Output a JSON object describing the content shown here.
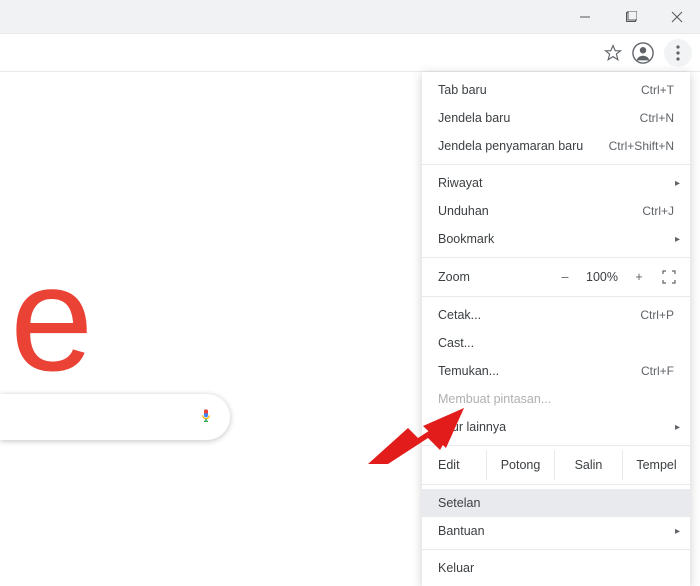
{
  "window_controls": {
    "minimize": "minimize",
    "maximize": "maximize",
    "close": "close"
  },
  "toolbar": {
    "star": "star-icon",
    "profile": "profile-icon",
    "menu": "menu-icon"
  },
  "logo_fragment": "e",
  "menu": {
    "items": [
      {
        "label": "Tab baru",
        "shortcut": "Ctrl+T"
      },
      {
        "label": "Jendela baru",
        "shortcut": "Ctrl+N"
      },
      {
        "label": "Jendela penyamaran baru",
        "shortcut": "Ctrl+Shift+N"
      }
    ],
    "group2": [
      {
        "label": "Riwayat",
        "submenu": true
      },
      {
        "label": "Unduhan",
        "shortcut": "Ctrl+J"
      },
      {
        "label": "Bookmark",
        "submenu": true
      }
    ],
    "zoom": {
      "label": "Zoom",
      "minus": "–",
      "value": "100%",
      "plus": "+"
    },
    "group3": [
      {
        "label": "Cetak...",
        "shortcut": "Ctrl+P"
      },
      {
        "label": "Cast..."
      },
      {
        "label": "Temukan...",
        "shortcut": "Ctrl+F"
      },
      {
        "label": "Membuat pintasan...",
        "disabled": true
      },
      {
        "label": "Fitur lainnya",
        "submenu": true
      }
    ],
    "edit": {
      "label": "Edit",
      "cut": "Potong",
      "copy": "Salin",
      "paste": "Tempel"
    },
    "group4": [
      {
        "label": "Setelan",
        "highlight": true
      },
      {
        "label": "Bantuan",
        "submenu": true
      }
    ],
    "exit": {
      "label": "Keluar"
    }
  },
  "submenu_glyph": "▸"
}
